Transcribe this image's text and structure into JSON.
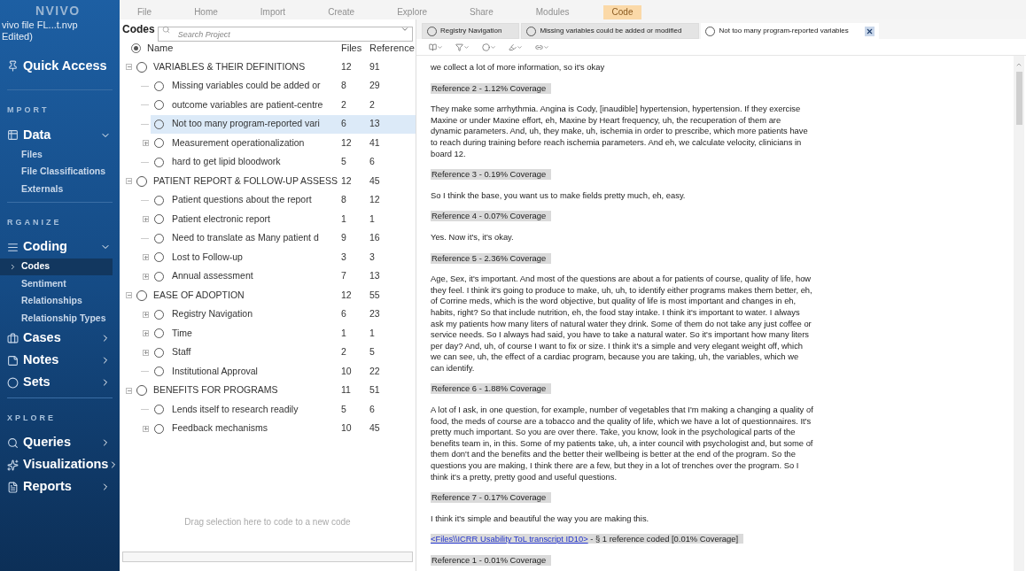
{
  "menu": {
    "items": [
      {
        "label": "File",
        "selected": false
      },
      {
        "label": "Home",
        "selected": false
      },
      {
        "label": "Import",
        "selected": false
      },
      {
        "label": "Create",
        "selected": false
      },
      {
        "label": "Explore",
        "selected": false
      },
      {
        "label": "Share",
        "selected": false
      },
      {
        "label": "Modules",
        "selected": false
      },
      {
        "label": "Code",
        "selected": true
      }
    ]
  },
  "sidebar": {
    "logo": "NVIVO",
    "project": "vivo file  FL...t.nvp",
    "project_state": "Edited)",
    "items": [
      {
        "kind": "link",
        "label": "Quick Access"
      },
      {
        "kind": "heading",
        "label": "MPORT"
      },
      {
        "kind": "group",
        "label": "Data",
        "expanded": true,
        "children": [
          {
            "label": "Files",
            "selected": false
          },
          {
            "label": "File Classifications",
            "selected": false
          },
          {
            "label": "Externals",
            "selected": false
          }
        ]
      },
      {
        "kind": "heading",
        "label": "RGANIZE"
      },
      {
        "kind": "group",
        "label": "Coding",
        "expanded": true,
        "children": [
          {
            "label": "Codes",
            "selected": true
          },
          {
            "label": "Sentiment",
            "selected": false
          },
          {
            "label": "Relationships",
            "selected": false
          },
          {
            "label": "Relationship Types",
            "selected": false
          }
        ]
      },
      {
        "kind": "group",
        "label": "Cases",
        "expanded": false
      },
      {
        "kind": "group",
        "label": "Notes",
        "expanded": false
      },
      {
        "kind": "group",
        "label": "Sets",
        "expanded": false
      },
      {
        "kind": "heading",
        "label": "XPLORE"
      },
      {
        "kind": "group",
        "label": "Queries",
        "expanded": false
      },
      {
        "kind": "group",
        "label": "Visualizations",
        "expanded": false
      },
      {
        "kind": "group",
        "label": "Reports",
        "expanded": false
      }
    ]
  },
  "codes": {
    "title": "Codes",
    "search": {
      "placeholder": "Search Project"
    },
    "columns": [
      "Name",
      "Files",
      "Reference"
    ],
    "empty_hint": "Drag selection here to code to a new code",
    "rows": [
      {
        "name": "VARIABLES & THEIR DEFINITIONS",
        "files": "12",
        "references": "91",
        "expanded": true,
        "children": [
          {
            "name": "Missing variables could be added or",
            "files": "8",
            "references": "29",
            "has_children": false,
            "selected": false
          },
          {
            "name": "outcome variables are patient-centre",
            "files": "2",
            "references": "2",
            "has_children": false,
            "selected": false
          },
          {
            "name": "Not too many program-reported vari",
            "files": "6",
            "references": "13",
            "has_children": false,
            "selected": true
          },
          {
            "name": "Measurement operationalization",
            "files": "12",
            "references": "41",
            "has_children": true,
            "selected": false
          },
          {
            "name": "hard to get lipid bloodwork",
            "files": "5",
            "references": "6",
            "has_children": false,
            "selected": false
          }
        ]
      },
      {
        "name": "PATIENT REPORT & FOLLOW-UP ASSESS",
        "files": "12",
        "references": "45",
        "expanded": true,
        "children": [
          {
            "name": "Patient questions about the report",
            "files": "8",
            "references": "12",
            "has_children": false,
            "selected": false
          },
          {
            "name": "Patient electronic report",
            "files": "1",
            "references": "1",
            "has_children": true,
            "selected": false
          },
          {
            "name": "Need to translate as Many patient d",
            "files": "9",
            "references": "16",
            "has_children": false,
            "selected": false
          },
          {
            "name": "Lost to Follow-up",
            "files": "3",
            "references": "3",
            "has_children": true,
            "selected": false
          },
          {
            "name": "Annual assessment",
            "files": "7",
            "references": "13",
            "has_children": true,
            "selected": false
          }
        ]
      },
      {
        "name": "EASE OF ADOPTION",
        "files": "12",
        "references": "55",
        "expanded": true,
        "children": [
          {
            "name": "Registry Navigation",
            "files": "6",
            "references": "23",
            "has_children": true,
            "selected": false
          },
          {
            "name": "Time",
            "files": "1",
            "references": "1",
            "has_children": true,
            "selected": false
          },
          {
            "name": "Staff",
            "files": "2",
            "references": "5",
            "has_children": true,
            "selected": false
          },
          {
            "name": "Institutional Approval",
            "files": "10",
            "references": "22",
            "has_children": false,
            "selected": false
          }
        ]
      },
      {
        "name": "BENEFITS FOR PROGRAMS",
        "files": "11",
        "references": "51",
        "expanded": true,
        "children": [
          {
            "name": "Lends itself to research readily",
            "files": "5",
            "references": "6",
            "has_children": false,
            "selected": false
          },
          {
            "name": "Feedback mechanisms",
            "files": "10",
            "references": "45",
            "has_children": true,
            "selected": false
          }
        ]
      }
    ]
  },
  "detail": {
    "tabs": [
      {
        "label": "Registry Navigation",
        "selected": false
      },
      {
        "label": "Missing variables could be added or modified",
        "selected": false
      },
      {
        "label": "Not too many program-reported variables",
        "selected": true
      }
    ],
    "blocks": [
      {
        "kind": "text",
        "text": "we collect a lot of more information, so it's okay"
      },
      {
        "kind": "reference",
        "text": "Reference 2 - 1.12% Coverage"
      },
      {
        "kind": "text",
        "text": "They make some arrhythmia. Angina is Cody, [inaudible] hypertension, hypertension. If they exercise Maxine or under Maxine effort, eh, Maxine by Heart frequency, uh, the recuperation of them are dynamic parameters. And, uh, they make, uh, ischemia in order to prescribe, which more patients have to reach during training before reach ischemia parameters. And eh, we calculate velocity, clinicians in board 12."
      },
      {
        "kind": "reference",
        "text": "Reference 3 - 0.19% Coverage"
      },
      {
        "kind": "text",
        "text": "So I think the base, you want us to make fields pretty much, eh, easy."
      },
      {
        "kind": "reference",
        "text": "Reference 4 - 0.07% Coverage"
      },
      {
        "kind": "text",
        "text": "Yes. Now it's, it's okay."
      },
      {
        "kind": "reference",
        "text": "Reference 5 - 2.36% Coverage"
      },
      {
        "kind": "text",
        "text": "Age, Sex, it's important. And most of the questions are about a for patients of course, quality of life, how they feel. I think it's going to produce to make, uh, uh, to identify either programs makes them better, eh, of Corrine meds, which is the word objective, but quality of life is most important and changes in eh, habits, right? So that include nutrition, eh, the food stay intake. I think it's important to water. I always ask my patients how many liters of natural water they drink. Some of them do not take any just coffee or service needs. So I always had said, you have to take a natural water. So it's important how many liters per day? And, uh, of course I want to fix or size. I think it's a simple and very elegant weight off, which we can see, uh, the effect of a cardiac program, because you are taking, uh, the variables, which we can identify."
      },
      {
        "kind": "reference",
        "text": "Reference 6 - 1.88% Coverage"
      },
      {
        "kind": "text",
        "text": "A lot of I ask, in one question, for example, number of vegetables that I'm making a changing a quality of food, the meds of course are a tobacco and the quality of life, which we have a lot of questionnaires. It's pretty much important. So you are over there. Take, you know, look in the psychological parts of the benefits team in, in this. Some of my patients take, uh, a inter council with psychologist and, but some of them don't and the benefits and the better their wellbeing is better at the end of the program. So the questions you are making, I think there are a few, but they in a lot of trenches over the program. So I think it's a pretty, pretty good and useful questions."
      },
      {
        "kind": "reference",
        "text": "Reference 7 - 0.17% Coverage"
      },
      {
        "kind": "text",
        "text": "I think it's simple and beautiful the way you are making this."
      },
      {
        "kind": "source",
        "link": "<Files\\\\ICRR Usability ToL transcript ID10>",
        "text": " - § 1 reference coded  [0.01% Coverage]"
      },
      {
        "kind": "reference",
        "text": "Reference 1 - 0.01% Coverage"
      }
    ]
  }
}
